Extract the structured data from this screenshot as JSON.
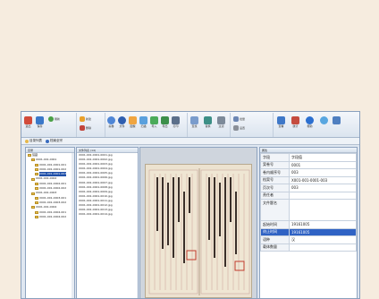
{
  "ribbon": {
    "groups": [
      {
        "label": "",
        "buttons": [
          {
            "label": "退出"
          },
          {
            "label": "保存"
          },
          {
            "label": "刷新"
          }
        ]
      },
      {
        "label": "",
        "buttons": [
          {
            "label": "新建"
          },
          {
            "label": "删除"
          }
        ]
      },
      {
        "label": "",
        "buttons": [
          {
            "label": "案卷"
          },
          {
            "label": "文件"
          },
          {
            "label": "图像"
          },
          {
            "label": "扫描"
          },
          {
            "label": "导入"
          },
          {
            "label": "导出"
          },
          {
            "label": "打印"
          }
        ]
      },
      {
        "label": "",
        "buttons": [
          {
            "label": "查找"
          },
          {
            "label": "替换"
          },
          {
            "label": "过滤"
          }
        ]
      },
      {
        "label": "",
        "buttons": [
          {
            "label": "批量"
          },
          {
            "label": "设置"
          }
        ]
      },
      {
        "label": "",
        "buttons": [
          {
            "label": "查看"
          },
          {
            "label": "统计"
          },
          {
            "label": "帮助"
          }
        ]
      }
    ]
  },
  "tabs": [
    {
      "label": "目录列表",
      "icon": "list-icon"
    },
    {
      "label": "档案全宗",
      "icon": "archive-icon"
    }
  ],
  "tree": {
    "header": "目录",
    "rows": [
      {
        "label": "馆藏",
        "depth": 0,
        "selected": false
      },
      {
        "label": "X001-001-0001",
        "depth": 1,
        "selected": false
      },
      {
        "label": "X001-001-0001-001",
        "depth": 2,
        "selected": false
      },
      {
        "label": "X001-001-0001-002",
        "depth": 2,
        "selected": false
      },
      {
        "label": "X001-001-0001-003",
        "depth": 2,
        "selected": true
      },
      {
        "label": "X001-001-0002",
        "depth": 1,
        "selected": false
      },
      {
        "label": "X001-001-0002-001",
        "depth": 2,
        "selected": false
      },
      {
        "label": "X001-001-0002-002",
        "depth": 2,
        "selected": false
      },
      {
        "label": "X001-001-0003",
        "depth": 1,
        "selected": false
      },
      {
        "label": "X001-001-0003-001",
        "depth": 2,
        "selected": false
      },
      {
        "label": "X001-001-0003-002",
        "depth": 2,
        "selected": false
      },
      {
        "label": "X001-001-0004",
        "depth": 1,
        "selected": false
      },
      {
        "label": "X001-001-0004-001",
        "depth": 2,
        "selected": false
      },
      {
        "label": "X001-001-0004-002",
        "depth": 2,
        "selected": false
      }
    ]
  },
  "files": {
    "header": "文件列表 (14)",
    "rows": [
      "X001-001-0001-0001.jpg",
      "X001-001-0001-0002.jpg",
      "X001-001-0001-0003.jpg",
      "X001-001-0001-0004.jpg",
      "X001-001-0001-0005.jpg",
      "X001-001-0001-0006.jpg",
      "X001-001-0001-0007.jpg",
      "X001-001-0001-0008.jpg",
      "X001-001-0001-0009.jpg",
      "X001-001-0001-0010.jpg",
      "X001-001-0001-0011.jpg",
      "X001-001-0001-0012.jpg",
      "X001-001-0001-0013.jpg",
      "X001-001-0001-0014.jpg"
    ]
  },
  "props": {
    "header": "属性",
    "rows": [
      {
        "key": "字段",
        "value": "字段值",
        "highlight": false,
        "tall": false
      },
      {
        "key": "案卷号",
        "value": "0001",
        "highlight": false,
        "tall": false
      },
      {
        "key": "卷内顺序号",
        "value": "003",
        "highlight": false,
        "tall": false
      },
      {
        "key": "档案号",
        "value": "X001-001-0001-003",
        "highlight": false,
        "tall": false
      },
      {
        "key": "页次号",
        "value": "003",
        "highlight": false,
        "tall": false
      },
      {
        "key": "责任者",
        "value": "",
        "highlight": false,
        "tall": false
      },
      {
        "key": "文件题名",
        "value": "",
        "highlight": false,
        "tall": true
      },
      {
        "key": "起始时间",
        "value": "19161005",
        "highlight": false,
        "tall": false
      },
      {
        "key": "终止时间",
        "value": "19161005",
        "highlight": true,
        "tall": false
      },
      {
        "key": "语种",
        "value": "汉",
        "highlight": false,
        "tall": false
      },
      {
        "key": "载体数量",
        "value": "",
        "highlight": false,
        "tall": false
      }
    ]
  },
  "colors": {
    "accent": "#2f62c4",
    "tree_selected": "#1f4fa8",
    "background": "#f6ecdf"
  }
}
